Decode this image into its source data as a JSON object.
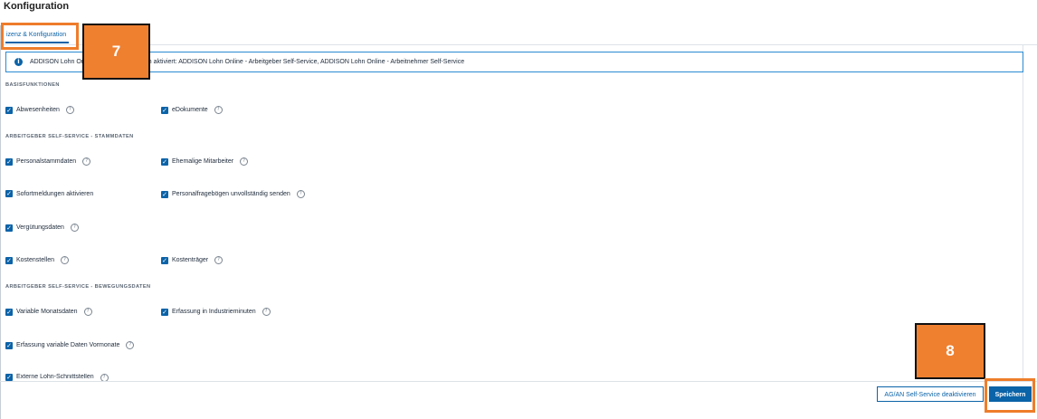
{
  "page": {
    "title": "Konfiguration"
  },
  "tabs": [
    {
      "label": "izenz & Konfiguration",
      "active": true
    }
  ],
  "info": {
    "icon": "info-icon",
    "text": "ADDISON Lohn Online: Folgende Lizenzen aktiviert: ADDISON Lohn Online - Arbeitgeber Self-Service, ADDISON Lohn Online - Arbeitnehmer Self-Service"
  },
  "sections": {
    "basis": "BASISFUNKTIONEN",
    "stammdaten": "ARBEITGEBER SELF-SERVICE - STAMMDATEN",
    "bewegungsdaten": "ARBEITGEBER SELF-SERVICE - BEWEGUNGSDATEN"
  },
  "checkboxes": {
    "abwesenheiten": {
      "label": "Abwesenheiten",
      "checked": true,
      "help": true
    },
    "edokumente": {
      "label": "eDokumente",
      "checked": true,
      "help": true
    },
    "personalstammdaten": {
      "label": "Personalstammdaten",
      "checked": true,
      "help": true
    },
    "ehemalige": {
      "label": "Ehemalige Mitarbeiter",
      "checked": true,
      "help": true
    },
    "sofortmeldungen": {
      "label": "Sofortmeldungen aktivieren",
      "checked": true,
      "help": false
    },
    "personalfrageboegen": {
      "label": "Personalfragebögen unvollständig senden",
      "checked": true,
      "help": true
    },
    "verguetungsdaten": {
      "label": "Vergütungsdaten",
      "checked": true,
      "help": true
    },
    "kostenstellen": {
      "label": "Kostenstellen",
      "checked": true,
      "help": true
    },
    "kostentraeger": {
      "label": "Kostenträger",
      "checked": true,
      "help": true
    },
    "variable_monatsdaten": {
      "label": "Variable Monatsdaten",
      "checked": true,
      "help": true
    },
    "industrieminuten": {
      "label": "Erfassung in Industrieminuten",
      "checked": true,
      "help": true
    },
    "variable_vormonate": {
      "label": "Erfassung variable Daten Vormonate",
      "checked": true,
      "help": true
    },
    "externe_schnittstellen": {
      "label": "Externe Lohn-Schnittstellen",
      "checked": true,
      "help": true
    }
  },
  "glyphs": {
    "check": "✓",
    "help": "?",
    "info": "i"
  },
  "footer": {
    "deactivate_label": "AG/AN Self-Service deaktivieren",
    "save_label": "Speichern"
  },
  "annotations": {
    "marker_7": "7",
    "marker_8": "8",
    "accent_color": "#ee7d2a"
  }
}
